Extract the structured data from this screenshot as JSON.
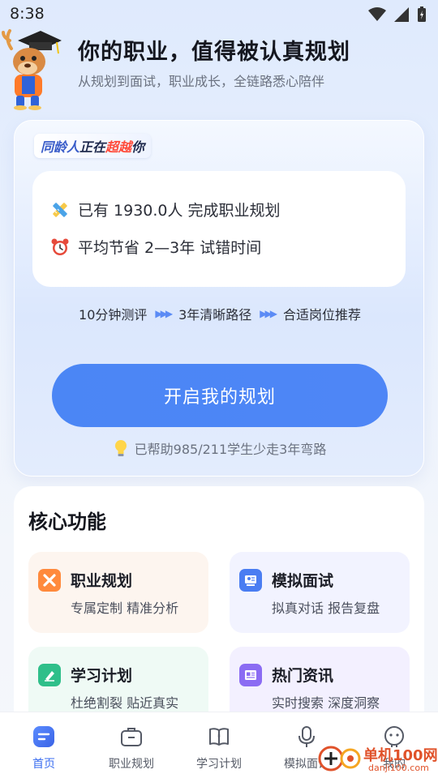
{
  "status_bar": {
    "time": "8:38"
  },
  "header": {
    "title": "你的职业，值得被认真规划",
    "subtitle": "从规划到面试，职业成长，全链路悉心陪伴"
  },
  "hero": {
    "badge": {
      "part1": "同龄人",
      "part2": "正在",
      "part3": "超越",
      "part4": "你"
    },
    "stats": [
      {
        "icon": "pencil-ruler-icon",
        "text": "已有 1930.0人 完成职业规划"
      },
      {
        "icon": "alarm-clock-icon",
        "text": "平均节省 2—3年 试错时间"
      }
    ],
    "steps": [
      "10分钟测评",
      "3年清晰路径",
      "合适岗位推荐"
    ],
    "cta_label": "开启我的规划",
    "helper_text": "已帮助985/211学生少走3年弯路",
    "colors": {
      "cta": "#4b86f5",
      "badge_highlight": "#ff4b3a"
    }
  },
  "core": {
    "title": "核心功能",
    "features": [
      {
        "title": "职业规划",
        "desc": "专属定制 精准分析",
        "icon": "career-plan-icon",
        "color": "#ff8a3d"
      },
      {
        "title": "模拟面试",
        "desc": "拟真对话 报告复盘",
        "icon": "interview-icon",
        "color": "#4a7df2"
      },
      {
        "title": "学习计划",
        "desc": "杜绝割裂 贴近真实",
        "icon": "study-plan-icon",
        "color": "#2fbf8a"
      },
      {
        "title": "热门资讯",
        "desc": "实时搜索 深度洞察",
        "icon": "news-icon",
        "color": "#8b6cf3"
      }
    ]
  },
  "nav": {
    "items": [
      {
        "label": "首页",
        "icon": "home-icon",
        "active": true
      },
      {
        "label": "职业规划",
        "icon": "briefcase-icon",
        "active": false
      },
      {
        "label": "学习计划",
        "icon": "book-icon",
        "active": false
      },
      {
        "label": "模拟面试",
        "icon": "microphone-icon",
        "active": false
      },
      {
        "label": "我的",
        "icon": "profile-icon",
        "active": false
      }
    ]
  },
  "watermark": {
    "text1": "单机100网",
    "text2": "danji100.com"
  }
}
